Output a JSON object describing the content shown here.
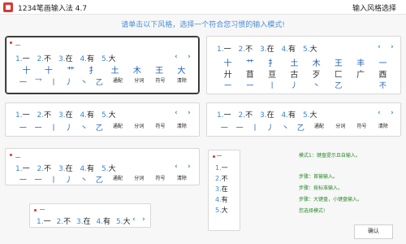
{
  "window": {
    "title": "1234笔画输入法 4.7",
    "right_title": "输入风格选择"
  },
  "instruction": "请单击以下风格，选择一个符合您习惯的输入模式!",
  "candidates": [
    {
      "n": "1.",
      "c": "一"
    },
    {
      "n": "2.",
      "c": "不"
    },
    {
      "n": "3.",
      "c": "在"
    },
    {
      "n": "4.",
      "c": "有"
    },
    {
      "n": "5.",
      "c": "大"
    }
  ],
  "nav": {
    "prev": "‹",
    "next": "›"
  },
  "keys_a": [
    "十",
    "十",
    "艹",
    "扌",
    "土",
    "木",
    "王",
    "大",
    "一",
    "乛",
    "丨",
    "丿",
    "丶",
    "乙",
    "通配",
    "分词",
    "符号",
    "清除"
  ],
  "keys_b_top": [
    "十",
    "艹",
    "扌",
    "土",
    "木",
    "王",
    "丰",
    "一"
  ],
  "keys_b_mid": [
    "廾",
    "苜",
    "亘",
    "古",
    "歹",
    "匚",
    "广",
    "酉"
  ],
  "keys_b_bot": [
    "一",
    "一",
    "丨",
    "丿",
    "丶",
    "乙",
    "",
    "不"
  ],
  "keys_c": [
    "一",
    "一",
    "丨",
    "丿",
    "丶",
    "乙",
    "通配",
    "分词",
    "符号",
    "清除"
  ],
  "keys_e": [
    "一",
    "一",
    "丨",
    "丿",
    "丶",
    "乙",
    "通配",
    "分词",
    "符号",
    "清除"
  ],
  "vertical_list": [
    {
      "n": "1.",
      "c": "一"
    },
    {
      "n": "2.",
      "c": "不"
    },
    {
      "n": "3.",
      "c": "在"
    },
    {
      "n": "4.",
      "c": "有"
    },
    {
      "n": "5.",
      "c": "大"
    }
  ],
  "info": {
    "mode": "模式1：键盘提示且自输入。",
    "step1": "步骤：首输输入。",
    "step2": "步骤：按标准输入。",
    "step3": "步骤：大键盘，小键盘输入。",
    "step4": "您选择模式!"
  },
  "confirm_label": "确认"
}
